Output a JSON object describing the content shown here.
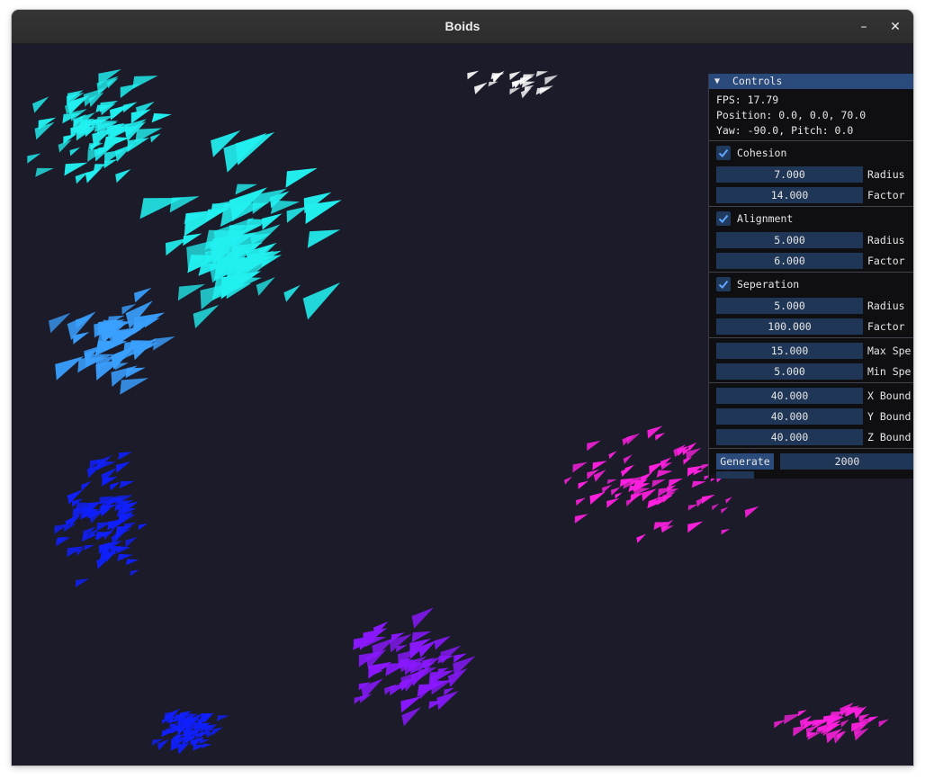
{
  "window": {
    "title": "Boids",
    "minimize_glyph": "–",
    "close_glyph": "✕"
  },
  "panel": {
    "title": "Controls",
    "fps": "FPS: 17.79",
    "position": "Position: 0.0, 0.0, 70.0",
    "yaw_pitch": "Yaw: -90.0, Pitch: 0.0",
    "cohesion": {
      "label": "Cohesion",
      "checked": true,
      "radius": "7.000",
      "factor": "14.000"
    },
    "alignment": {
      "label": "Alignment",
      "checked": true,
      "radius": "5.000",
      "factor": "6.000"
    },
    "seperation": {
      "label": "Seperation",
      "checked": true,
      "radius": "5.000",
      "factor": "100.000"
    },
    "labels": {
      "radius": "Radius",
      "factor": "Factor"
    },
    "max_speed": {
      "value": "15.000",
      "label": "Max Spe"
    },
    "min_speed": {
      "value": "5.000",
      "label": "Min Spe"
    },
    "x_bounds": {
      "value": "40.000",
      "label": "X Bound:"
    },
    "y_bounds": {
      "value": "40.000",
      "label": "Y Bound:"
    },
    "z_bounds": {
      "value": "40.000",
      "label": "Z Bound:"
    },
    "generate_label": "Generate",
    "generate_count": "2000"
  },
  "colors": {
    "scene_bg": "#1b1b2a",
    "cyan": "#22f0f0",
    "light_blue": "#3aa0ff",
    "blue": "#1020ff",
    "violet": "#8a18ff",
    "magenta": "#ff20e0",
    "white": "#ffffff",
    "accent": "#294a7a"
  },
  "icons": {
    "collapse": "triangle-down-icon",
    "check": "checkmark-icon"
  }
}
